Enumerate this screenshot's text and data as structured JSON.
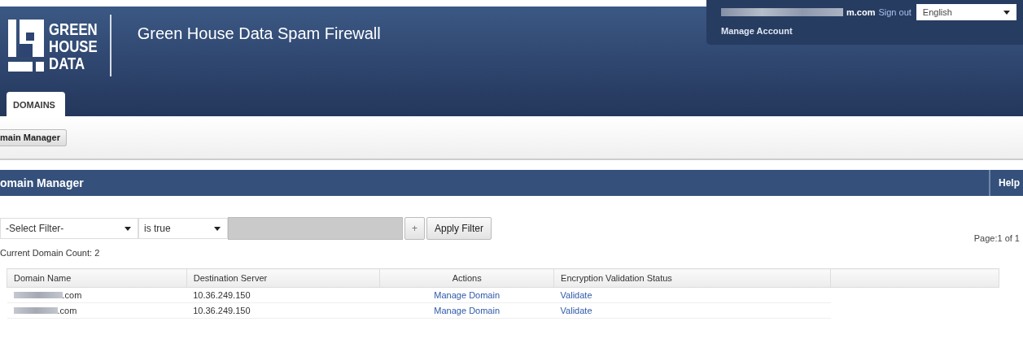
{
  "header": {
    "logo_lines": [
      "GREEN",
      "HOUSE",
      "DATA"
    ],
    "title": "Green House Data Spam Firewall",
    "account": {
      "email": "m.com",
      "sign_out": "Sign out",
      "language": "English",
      "manage": "Manage Account"
    }
  },
  "tabs": [
    {
      "label": "DOMAINS",
      "selected": true
    }
  ],
  "subnav": [
    {
      "label": "main Manager"
    }
  ],
  "section": {
    "title": "omain Manager",
    "help": "Help"
  },
  "filter": {
    "field": "-Select Filter-",
    "operator": "is true",
    "add": "+",
    "apply": "Apply Filter"
  },
  "count": "Current Domain Count: 2",
  "pager": "Page:1 of 1",
  "table": {
    "columns": [
      "Domain Name",
      "Destination Server",
      "Actions",
      "Encryption Validation Status"
    ],
    "rows": [
      {
        "domain": ".com",
        "server": "10.36.249.150",
        "action": "Manage Domain",
        "status": "Validate"
      },
      {
        "domain": ".com",
        "server": "10.36.249.150",
        "action": "Manage Domain",
        "status": "Validate"
      }
    ]
  }
}
